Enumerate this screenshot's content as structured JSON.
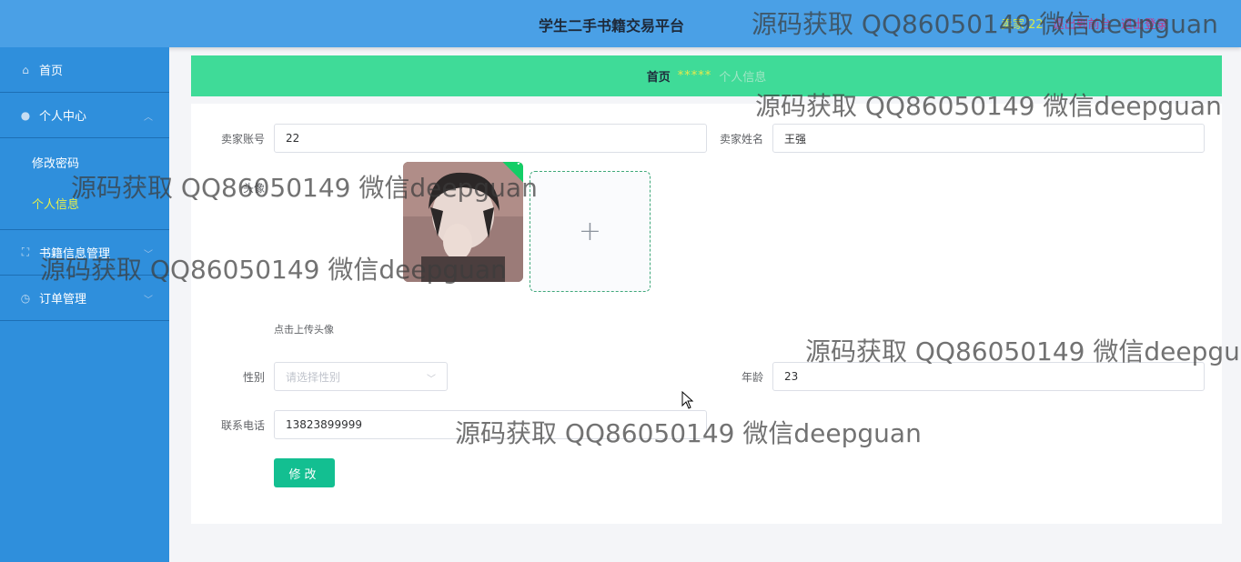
{
  "header": {
    "title": "学生二手书籍交易平台",
    "user_label": "卖家 22",
    "link1": "退出到前台",
    "link2": "退出登录"
  },
  "sidebar": {
    "items": [
      {
        "label": "首页",
        "icon": "home-icon"
      },
      {
        "label": "个人中心",
        "icon": "user-icon",
        "children": [
          "修改密码",
          "个人信息"
        ]
      },
      {
        "label": "书籍信息管理",
        "icon": "expand-icon"
      },
      {
        "label": "订单管理",
        "icon": "clock-icon"
      }
    ]
  },
  "breadcrumb": {
    "home": "首页",
    "separator": "*****",
    "current": "个人信息"
  },
  "form": {
    "account_label": "卖家账号",
    "account_value": "22",
    "name_label": "卖家姓名",
    "name_value": "王强",
    "avatar_label": "头像",
    "upload_hint": "点击上传头像",
    "gender_label": "性别",
    "gender_placeholder": "请选择性别",
    "age_label": "年龄",
    "age_value": "23",
    "phone_label": "联系电话",
    "phone_value": "13823899999",
    "submit_label": "修改"
  },
  "watermark": "源码获取 QQ86050149 微信deepguan",
  "colors": {
    "header": "#4aa0e6",
    "sidebar": "#2f8fdc",
    "breadcrumb": "#3fdb98",
    "button": "#13bf91"
  }
}
